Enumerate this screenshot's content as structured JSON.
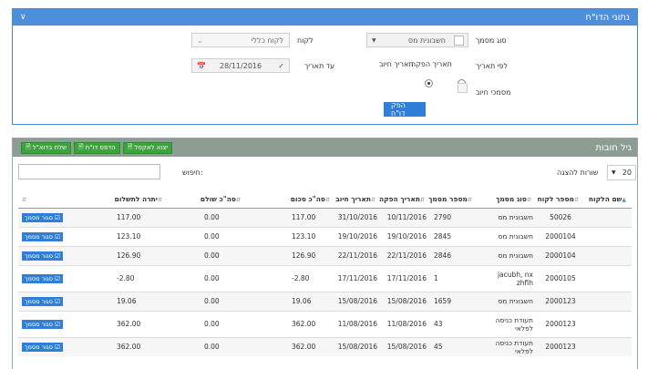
{
  "panel1": {
    "title": "נתוני הדו\"ח",
    "doc_type_label": "סוג מסמך",
    "doc_type_value": "חשבונית מס",
    "customer_label": "לקוח",
    "customer_value": "לקוח כללי",
    "by_date_label": "לפי תאריך",
    "radio_due": "תאריך חיוב",
    "radio_issue": "תאריך הפקה",
    "until_date_label": "עד תאריך",
    "until_date_value": "28/11/2016",
    "billing_docs_label": "מסמכי חיוב",
    "generate_button": "הפק דו\"ח"
  },
  "panel2": {
    "title": "גיל חובות",
    "btn_excel": "יצוא לאקסל",
    "btn_print": "הדפס דו\"ח",
    "btn_email": "שלח בדוא\"ל",
    "rows_label": "שורות להצגה",
    "rows_value": "20",
    "search_label": "חיפוש:",
    "columns": [
      "שם הלקוח",
      "מספר לקוח",
      "סוג מסמך",
      "מספר מסמך",
      "תאריך הפקה",
      "תאריך חיוב",
      "סה\"כ סכום",
      "סה\"כ שולם",
      "יתרה לתשלום",
      ""
    ],
    "action_label": "סגור מסמך",
    "rows": [
      {
        "name": "",
        "cust_no": "50026",
        "doc_type": "חשבונית מס",
        "doc_no": "2790",
        "issue": "10/11/2016",
        "due": "31/10/2016",
        "total": "117.00",
        "paid": "0.00",
        "balance": "117.00"
      },
      {
        "name": "",
        "cust_no": "2000104",
        "doc_type": "חשבונית מס",
        "doc_no": "2845",
        "issue": "19/10/2016",
        "due": "19/10/2016",
        "total": "123.10",
        "paid": "0.00",
        "balance": "123.10"
      },
      {
        "name": "",
        "cust_no": "2000104",
        "doc_type": "חשבונית מס",
        "doc_no": "2846",
        "issue": "22/11/2016",
        "due": "22/11/2016",
        "total": "126.90",
        "paid": "0.00",
        "balance": "126.90"
      },
      {
        "name": "",
        "cust_no": "2000105",
        "doc_type": "jacubh, nx zhfih",
        "doc_no": "1",
        "issue": "17/11/2016",
        "due": "17/11/2016",
        "total": "2.80-",
        "paid": "0.00",
        "balance": "2.80-"
      },
      {
        "name": "",
        "cust_no": "2000123",
        "doc_type": "חשבונית מס",
        "doc_no": "1659",
        "issue": "15/08/2016",
        "due": "15/08/2016",
        "total": "19.06",
        "paid": "0.00",
        "balance": "19.06"
      },
      {
        "name": "",
        "cust_no": "2000123",
        "doc_type": "תעודת כניסה לפלאי",
        "doc_no": "43",
        "issue": "11/08/2016",
        "due": "11/08/2016",
        "total": "362.00",
        "paid": "0.00",
        "balance": "362.00"
      },
      {
        "name": "",
        "cust_no": "2000123",
        "doc_type": "תעודת כניסה לפלאי",
        "doc_no": "45",
        "issue": "15/08/2016",
        "due": "15/08/2016",
        "total": "362.00",
        "paid": "0.00",
        "balance": "362.00"
      }
    ]
  },
  "colors": {
    "header_blue": "#4e8fdc",
    "header_gray": "#8d9d93",
    "btn_green": "#3ea33e",
    "btn_blue": "#2f7fd9"
  }
}
